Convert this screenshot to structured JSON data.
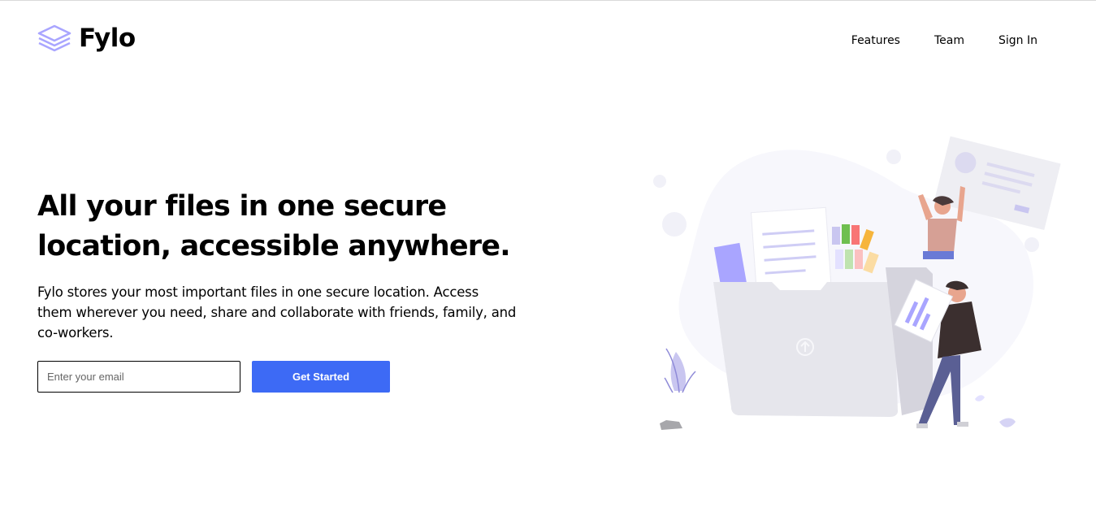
{
  "brand": {
    "name": "Fylo",
    "icon": "stacked-layers-icon",
    "accent": "#a9a5ff"
  },
  "nav": {
    "items": [
      "Features",
      "Team",
      "Sign In"
    ]
  },
  "hero": {
    "title": "All your files in one secure location, accessible anywhere.",
    "text": "Fylo stores your most important files in one secure location. Access them wherever you need, share and collaborate with friends, family, and co-workers.",
    "email_placeholder": "Enter your email",
    "cta_label": "Get Started"
  },
  "colors": {
    "cta": "#3d6af5",
    "text": "#000000",
    "background": "#ffffff"
  }
}
